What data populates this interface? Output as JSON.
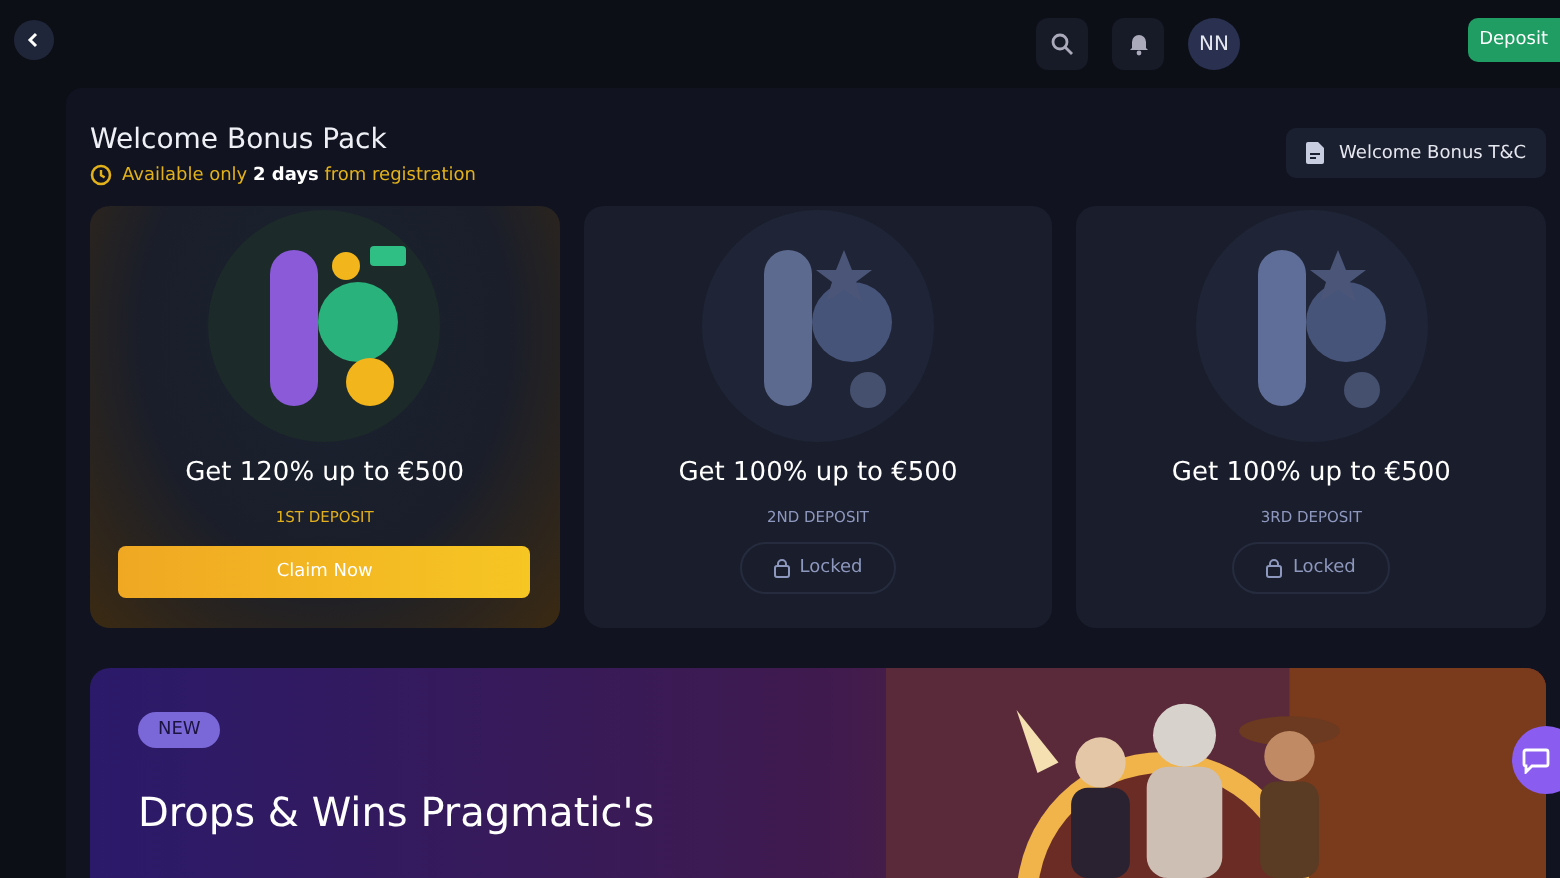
{
  "topbar": {
    "avatar": "NN",
    "deposit_button": "Deposit"
  },
  "bonus_pack": {
    "title": "Welcome Bonus Pack",
    "availability": "Available only **2 days** from registration",
    "terms_button": "Welcome Bonus T&C",
    "cards": [
      {
        "kind": "first",
        "offer": "Get 120% up to €500",
        "step": "1ST DEPOSIT",
        "action": "Claim Now",
        "locked": false
      },
      {
        "kind": "second",
        "offer": "Get 100% up to €500",
        "step": "2ND DEPOSIT",
        "action": "Locked",
        "locked": true
      },
      {
        "kind": "third",
        "offer": "Get 100% up to €500",
        "step": "3RD DEPOSIT",
        "action": "Locked",
        "locked": true
      }
    ]
  },
  "promo_banner": {
    "badge": "NEW",
    "title": "Drops & Wins Pragmatic's"
  }
}
